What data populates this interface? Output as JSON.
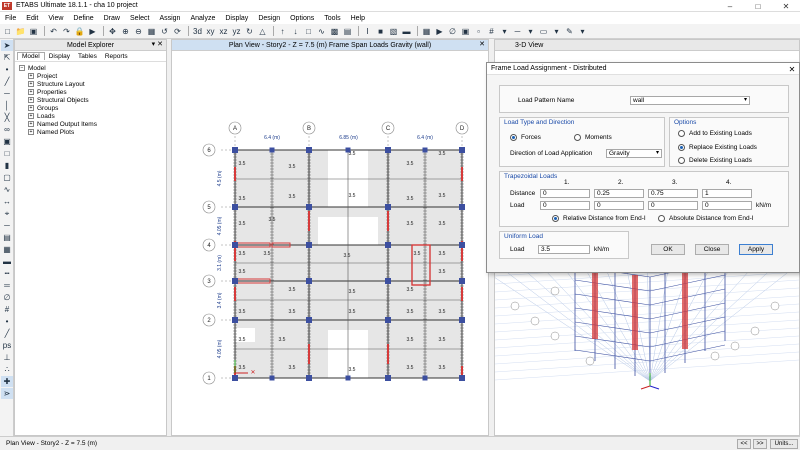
{
  "app": {
    "icon_text": "ET",
    "title": "ETABS Ultimate 18.1.1 - cha 10 project"
  },
  "menu": [
    "File",
    "Edit",
    "View",
    "Define",
    "Draw",
    "Select",
    "Assign",
    "Analyze",
    "Display",
    "Design",
    "Options",
    "Tools",
    "Help"
  ],
  "explorer": {
    "title": "Model Explorer",
    "tabs": [
      "Model",
      "Display",
      "Tables",
      "Reports"
    ],
    "root": "Model",
    "items": [
      "Project",
      "Structure Layout",
      "Properties",
      "Structural Objects",
      "Groups",
      "Loads",
      "Named Output Items",
      "Named Plots"
    ]
  },
  "plan_view": {
    "title": "Plan View - Story2 - Z = 7.5 (m)  Frame Span Loads Gravity (wall)",
    "grid_cols": [
      "A",
      "B",
      "C",
      "D"
    ],
    "grid_rows": [
      "6",
      "5",
      "4",
      "3",
      "2",
      "1"
    ],
    "col_dims": [
      "6.4 (m)",
      "6.85 (m)",
      "6.4 (m)"
    ],
    "row_dims": [
      "4.5 (m)",
      "4.05 (m)",
      "3.1 (m)",
      "3.4 (m)",
      "4.05 (m)"
    ],
    "load_label": "3.5"
  },
  "view3d": {
    "title": "3-D View"
  },
  "dialog": {
    "title": "Frame Load Assignment - Distributed",
    "load_pattern_label": "Load Pattern Name",
    "load_pattern_value": "wall",
    "type_dir_title": "Load Type and Direction",
    "forces_label": "Forces",
    "moments_label": "Moments",
    "direction_label": "Direction of Load Application",
    "direction_value": "Gravity",
    "options_title": "Options",
    "opt_add": "Add to Existing Loads",
    "opt_replace": "Replace Existing Loads",
    "opt_delete": "Delete Existing Loads",
    "trap_title": "Trapezoidal Loads",
    "trap_cols": [
      "1.",
      "2.",
      "3.",
      "4."
    ],
    "distance_label": "Distance",
    "distance_values": [
      "0",
      "0.25",
      "0.75",
      "1"
    ],
    "load_label": "Load",
    "load_values": [
      "0",
      "0",
      "0",
      "0"
    ],
    "load_units": "kN/m",
    "rel_dist_label": "Relative Distance from End-I",
    "abs_dist_label": "Absolute Distance from End-I",
    "uniform_title": "Uniform Load",
    "uniform_label": "Load",
    "uniform_value": "3.5",
    "uniform_units": "kN/m",
    "ok": "OK",
    "close": "Close",
    "apply": "Apply"
  },
  "status": {
    "text": "Plan View - Story2 - Z = 7.5 (m)",
    "btn_prev": "<<",
    "btn_next": ">>",
    "units": "Units..."
  },
  "colors": {
    "accent": "#1a5fb4",
    "wall": "#d63a3a",
    "column": "#3c4fa0"
  }
}
